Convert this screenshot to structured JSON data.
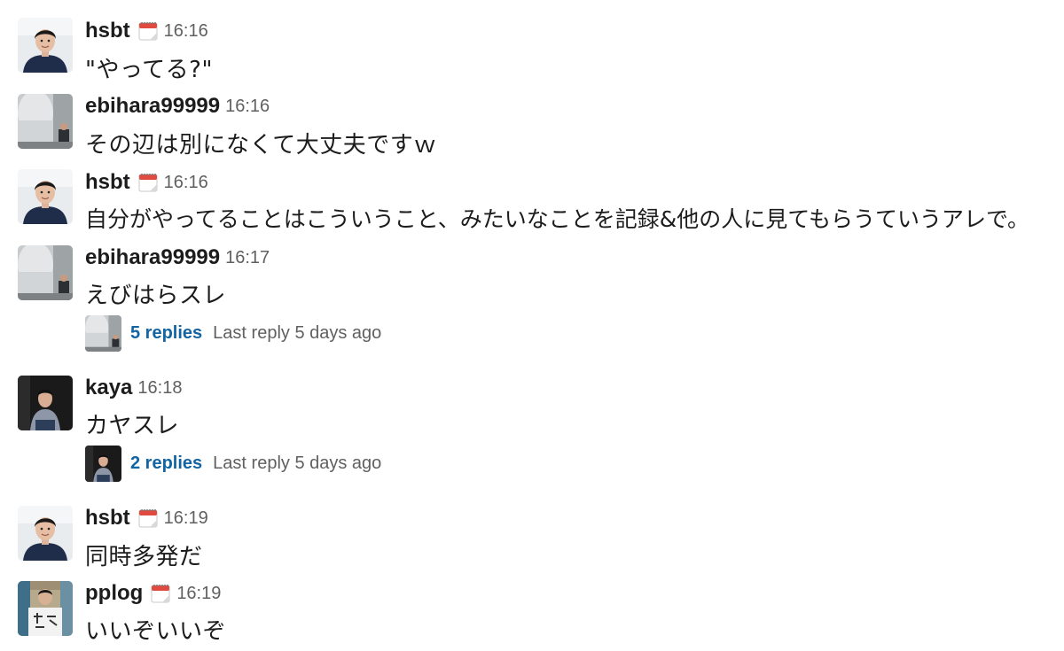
{
  "messages": [
    {
      "author": "hsbt",
      "time": "16:16",
      "text": "\"やってる?\"",
      "status_icon": "calendar-icon",
      "avatar": "hsbt-avatar"
    },
    {
      "author": "ebihara99999",
      "time": "16:16",
      "text": "その辺は別になくて大丈夫ですｗ",
      "avatar": "ebihara-avatar"
    },
    {
      "author": "hsbt",
      "time": "16:16",
      "text": "自分がやってることはこういうこと、みたいなことを記録&他の人に見てもらうていうアレで。",
      "status_icon": "calendar-icon",
      "avatar": "hsbt-avatar"
    },
    {
      "author": "ebihara99999",
      "time": "16:17",
      "text": "えびはらスレ",
      "avatar": "ebihara-avatar",
      "thread": {
        "replies": "5 replies",
        "last_reply": "Last reply 5 days ago"
      }
    },
    {
      "author": "kaya",
      "time": "16:18",
      "text": "カヤスレ",
      "avatar": "kaya-avatar",
      "thread": {
        "replies": "2 replies",
        "last_reply": "Last reply 5 days ago"
      }
    },
    {
      "author": "hsbt",
      "time": "16:19",
      "text": "同時多発だ",
      "status_icon": "calendar-icon",
      "avatar": "hsbt-avatar"
    },
    {
      "author": "pplog",
      "time": "16:19",
      "text": "いいぞいいぞ",
      "status_icon": "calendar-icon",
      "avatar": "pplog-avatar"
    }
  ],
  "colors": {
    "link": "#1264a3",
    "muted": "#616061",
    "text": "#1d1c1d"
  }
}
